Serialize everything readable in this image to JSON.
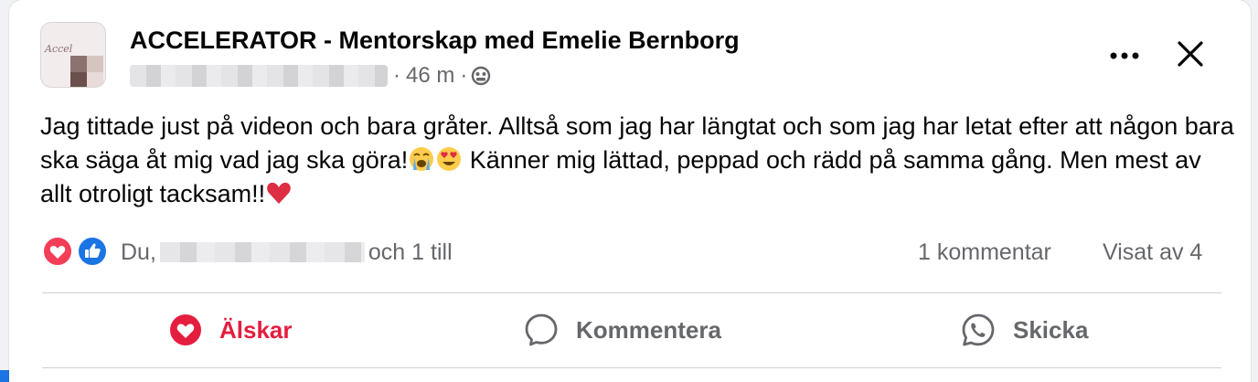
{
  "post": {
    "group_name": "ACCELERATOR - Mentorskap med Emelie Bernborg",
    "time": "46 m",
    "separator": "·",
    "body_part1": "Jag tittade just på videon och bara gråter. Alltså som jag har längtat och som jag har letat efter att någon bara ska säga åt mig vad jag ska göra!",
    "body_part2": " Känner mig lättad, peppad och rädd på samma gång. Men mest av allt otroligt tacksam!!",
    "avatar_script": "Accel"
  },
  "reactions": {
    "prefix": "Du,",
    "suffix": "och 1 till",
    "comments": "1 kommentar",
    "views": "Visat av 4"
  },
  "actions": {
    "love": "Älskar",
    "comment": "Kommentera",
    "send": "Skicka"
  },
  "icons": [
    "globe-icon",
    "more-icon",
    "close-icon",
    "loudly-crying-emoji",
    "heart-eyes-emoji",
    "red-heart-emoji",
    "love-reaction-icon",
    "like-reaction-icon",
    "heart-icon",
    "comment-icon",
    "whatsapp-icon"
  ],
  "colors": {
    "love_red": "#e41e3f",
    "like_blue": "#1b74e4",
    "muted_text": "#65676b"
  }
}
